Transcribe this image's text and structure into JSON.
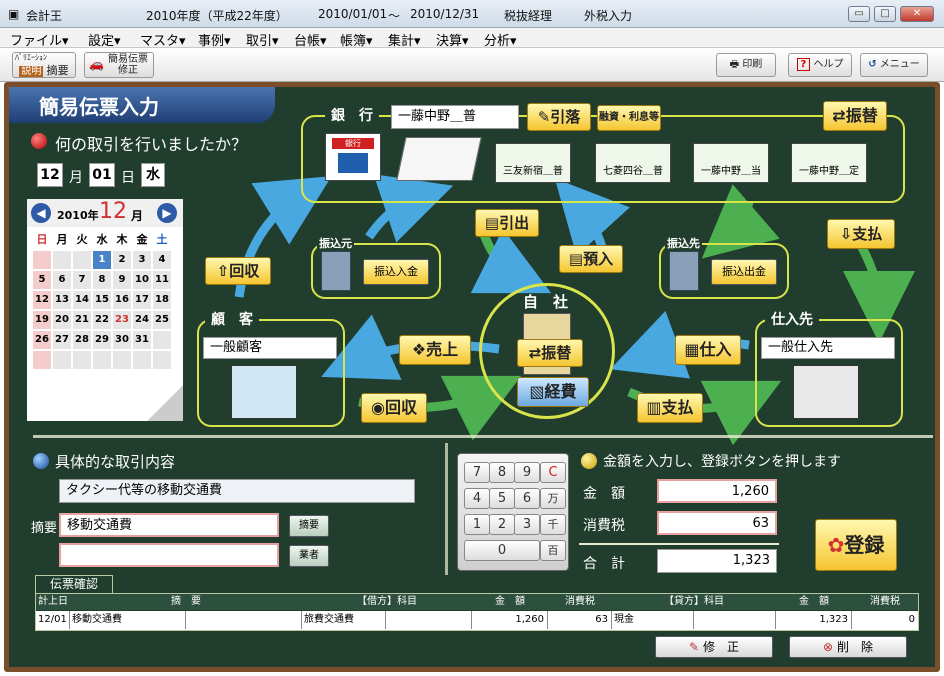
{
  "window": {
    "app_name": "会計王",
    "fiscal_year": "2010年度（平成22年度）",
    "period_from": "2010/01/01",
    "period_tilde": "〜",
    "period_to": "2010/12/31",
    "tax_mode": "税抜経理",
    "tax_input": "外税入力",
    "min": "▭",
    "max": "□",
    "close": "✕"
  },
  "menu": [
    "ファイル▾",
    "設定▾",
    "マスタ▾",
    "事例▾",
    "取引▾",
    "台帳▾",
    "帳簿▾",
    "集計▾",
    "決算▾",
    "分析▾"
  ],
  "toolbar": {
    "explain_top": "ﾊﾞﾘｴｰｼｮﾝ",
    "explain": "説明",
    "summary": "摘要",
    "simple_top": "簡易伝票",
    "simple_bottom": "修正",
    "print": "印刷",
    "help": "ヘルプ",
    "menu": "メニュー"
  },
  "page": {
    "title": "簡易伝票入力",
    "question": "何の取引を行いましたか？"
  },
  "date": {
    "month": "12",
    "month_unit": "月",
    "day": "01",
    "day_unit": "日",
    "weekday": "水"
  },
  "calendar": {
    "year": "2010年",
    "month": "12",
    "month_unit": "月",
    "weekdays": [
      "日",
      "月",
      "火",
      "水",
      "木",
      "金",
      "土"
    ],
    "rows": [
      [
        "",
        "",
        "",
        "1",
        "2",
        "3",
        "4"
      ],
      [
        "5",
        "6",
        "7",
        "8",
        "9",
        "10",
        "11"
      ],
      [
        "12",
        "13",
        "14",
        "15",
        "16",
        "17",
        "18"
      ],
      [
        "19",
        "20",
        "21",
        "22",
        "23",
        "24",
        "25"
      ],
      [
        "26",
        "27",
        "28",
        "29",
        "30",
        "31",
        ""
      ],
      [
        "",
        "",
        "",
        "",
        "",
        "",
        ""
      ]
    ]
  },
  "bank": {
    "label": "銀　行",
    "account": "一藤中野＿普",
    "withdraw": "引落",
    "finance": "融資・利息等",
    "transfer": "振替",
    "cards": [
      "三友新宿＿普",
      "七菱四谷＿普",
      "一藤中野＿当",
      "一藤中野＿定"
    ],
    "icon_label": "銀行"
  },
  "flow": {
    "from_label": "振込元",
    "from_btn": "振込入金",
    "to_label": "振込先",
    "to_btn": "振込出金",
    "withdraw": "引出",
    "deposit": "預入",
    "collect_up": "回収",
    "pay_right": "支払",
    "sales": "売上",
    "collect": "回収",
    "purchase": "仕入",
    "pay": "支払"
  },
  "customer": {
    "label": "顧　客",
    "name": "一般顧客"
  },
  "supplier": {
    "label": "仕入先",
    "name": "一般仕入先"
  },
  "company": {
    "label": "自　社",
    "transfer": "振替",
    "expense": "経費"
  },
  "detail": {
    "heading": "具体的な取引内容",
    "description": "タクシー代等の移動交通費",
    "summary_label": "摘要",
    "summary_value": "移動交通費",
    "summary_value2": "",
    "summary_btn": "摘要",
    "vendor_btn": "業者"
  },
  "keypad": {
    "keys": [
      "7",
      "8",
      "9",
      "C",
      "4",
      "5",
      "6",
      "万",
      "1",
      "2",
      "3",
      "千",
      "0",
      "百"
    ]
  },
  "amount": {
    "heading": "金額を入力し、登録ボタンを押します",
    "amount_label": "金　額",
    "amount_value": "1,260",
    "tax_label": "消費税",
    "tax_value": "63",
    "total_label": "合　計",
    "total_value": "1,323",
    "register": "登録"
  },
  "voucher": {
    "tab": "伝票確認",
    "headers": [
      "計上日",
      "摘　要",
      "【借方】科目",
      "金　額",
      "消費税",
      "【貸方】科目",
      "金　額",
      "消費税"
    ],
    "row": {
      "date": "12/01",
      "summary": "移動交通費",
      "debit_account": "旅費交通費",
      "debit_amount": "1,260",
      "debit_tax": "63",
      "credit_account": "現金",
      "credit_amount": "1,323",
      "credit_tax": "0"
    },
    "edit": "修　正",
    "delete": "削　除"
  },
  "colors": {
    "board": "#203d2e",
    "frame": "#d8e44a",
    "arrow": "#4caf50",
    "arrow_blue": "#4aa8e0",
    "button": "#f5c530"
  }
}
